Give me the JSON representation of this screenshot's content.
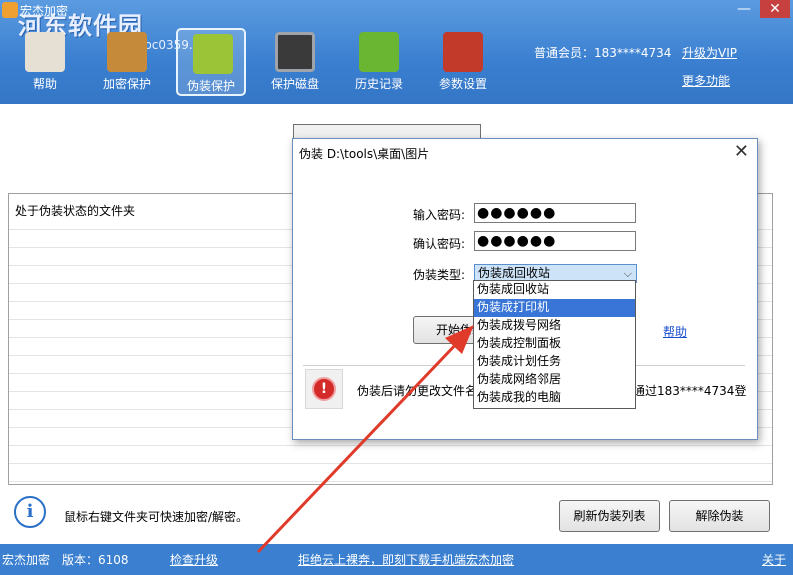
{
  "window": {
    "title": "宏杰加密",
    "minimize": "—",
    "close": "✕"
  },
  "watermark": {
    "main": "河东软件园",
    "sub": "www.pc0359.cn"
  },
  "toolbar": {
    "buttons": [
      {
        "label": "帮助",
        "icon": "help-book-icon"
      },
      {
        "label": "加密保护",
        "icon": "padlock-icon"
      },
      {
        "label": "伪装保护",
        "icon": "disguise-icon"
      },
      {
        "label": "保护磁盘",
        "icon": "floppy-disk-icon"
      },
      {
        "label": "历史记录",
        "icon": "history-chart-icon"
      },
      {
        "label": "参数设置",
        "icon": "toolbox-settings-icon"
      }
    ],
    "active_index": 2
  },
  "account": {
    "member": "普通会员：183****4734",
    "upgrade": "升级为VIP",
    "more": "更多功能"
  },
  "main": {
    "list_header": "处于伪装状态的文件夹",
    "tip": "鼠标右键文件夹可快速加密/解密。",
    "refresh_button": "刷新伪装列表",
    "remove_button": "解除伪装"
  },
  "status_bar": {
    "app": "宏杰加密",
    "version": "版本：6108",
    "check_update": "检查升级",
    "promo": "拒绝云上裸奔，即刻下载手机端宏杰加密",
    "close": "关于"
  },
  "dialog": {
    "title": "伪装 D:\\tools\\桌面\\图片",
    "close": "✕",
    "password_label": "输入密码:",
    "password_value": "●●●●●●",
    "confirm_label": "确认密码:",
    "confirm_value": "●●●●●●",
    "type_label": "伪装类型:",
    "type_selected": "伪装成回收站",
    "start_button": "开始伪装",
    "help_link": "帮助",
    "notice_left": "伪装后请勿更改文件名",
    "notice_right": "通过183****4734登"
  },
  "dropdown": {
    "options": [
      "伪装成回收站",
      "伪装成打印机",
      "伪装成拨号网络",
      "伪装成控制面板",
      "伪装成计划任务",
      "伪装成网络邻居",
      "伪装成我的电脑"
    ],
    "highlighted_index": 1
  },
  "colors": {
    "header_blue": "#3a7fd0",
    "selection_blue": "#3875d7",
    "arrow_red": "#e03a2a"
  }
}
